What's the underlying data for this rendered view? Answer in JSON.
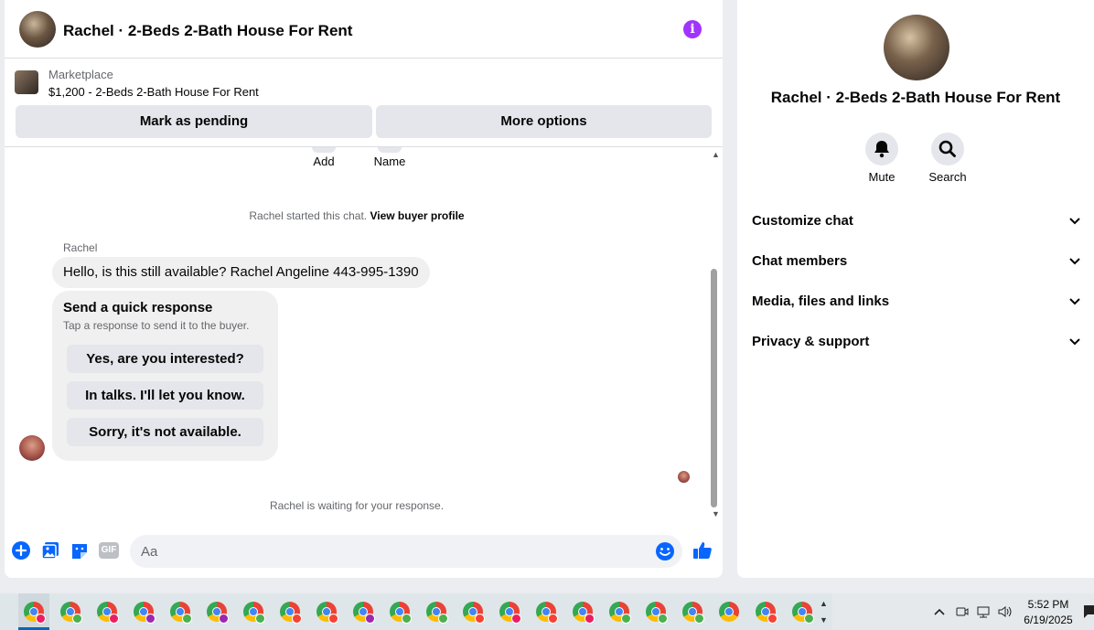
{
  "header": {
    "title": "Rachel · 2-Beds 2-Bath House For Rent",
    "info_icon": "i"
  },
  "marketplace": {
    "label": "Marketplace",
    "listing": "$1,200 - 2-Beds 2-Bath House For Rent",
    "pending_button": "Mark as pending",
    "more_button": "More options"
  },
  "thread": {
    "top_actions": [
      "Add",
      "Name"
    ],
    "started_text": "Rachel started this chat.",
    "buyer_profile_link": "View buyer profile",
    "sender_name": "Rachel",
    "message": "Hello, is this still available? Rachel Angeline 443-995-1390",
    "quick_response": {
      "title": "Send a quick response",
      "subtitle": "Tap a response to send it to the buyer.",
      "options": [
        "Yes, are you interested?",
        "In talks. I'll let you know.",
        "Sorry, it's not available."
      ]
    },
    "waiting_text": "Rachel is waiting for your response."
  },
  "composer": {
    "placeholder": "Aa",
    "gif_label": "GIF"
  },
  "details": {
    "title": "Rachel · 2-Beds 2-Bath House For Rent",
    "actions": [
      {
        "label": "Mute",
        "icon": "bell-icon"
      },
      {
        "label": "Search",
        "icon": "search-icon"
      }
    ],
    "sections": [
      "Customize chat",
      "Chat members",
      "Media, files and links",
      "Privacy & support"
    ]
  },
  "taskbar": {
    "time": "5:52 PM",
    "date": "6/19/2025",
    "app_count": 22
  },
  "colors": {
    "accent": "#0866ff",
    "info": "#a033ff",
    "bubble": "#f0f0f0",
    "button": "#e4e6eb"
  }
}
